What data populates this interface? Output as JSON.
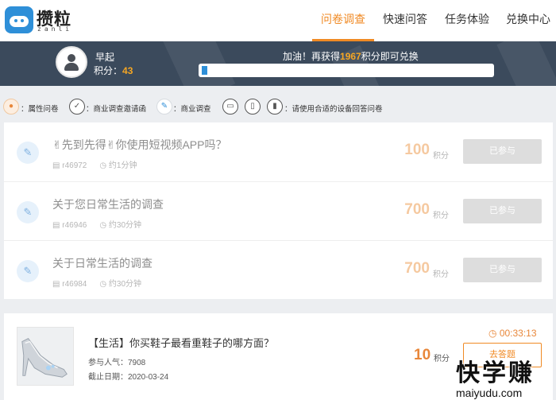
{
  "brand": {
    "name": "攒粒",
    "sub": "zanli"
  },
  "nav": {
    "items": [
      "问卷调查",
      "快速问答",
      "任务体验",
      "兑换中心"
    ],
    "active_index": 0
  },
  "user": {
    "name": "早起",
    "points_label": "积分：",
    "points": "43",
    "cheer_before": "加油！再获得",
    "cheer_points": "1967",
    "cheer_after": "积分即可兑换",
    "progress_fraction": 0.02
  },
  "filters": {
    "items": [
      {
        "icon": "user-plus-icon",
        "label": "：属性问卷"
      },
      {
        "icon": "check-circle-icon",
        "label": "：商业调查邀请函"
      },
      {
        "icon": "edit-icon",
        "label": "：商业调查"
      }
    ],
    "device_icons": [
      "monitor-icon",
      "phone-icon",
      "tablet-icon"
    ],
    "device_label": "：请使用合适的设备回答问卷"
  },
  "surveys": [
    {
      "title": "✌先到先得✌你使用短视频APP吗？",
      "id": "r46972",
      "duration": "约1分钟",
      "points": "100",
      "points_label": "积分",
      "button": "已参与"
    },
    {
      "title": "关于您日常生活的调查",
      "id": "r46946",
      "duration": "约30分钟",
      "points": "700",
      "points_label": "积分",
      "button": "已参与"
    },
    {
      "title": "关于日常生活的调查",
      "id": "r46984",
      "duration": "约30分钟",
      "points": "700",
      "points_label": "积分",
      "button": "已参与"
    }
  ],
  "product": {
    "title": "【生活】你买鞋子最看重鞋子的哪方面？",
    "popularity_label": "参与人气：",
    "popularity": "7908",
    "deadline_label": "截止日期：",
    "deadline": "2020-03-24",
    "timer": "00:33:13",
    "points": "10",
    "points_label": "积分",
    "button": "去答题"
  },
  "watermark": {
    "big": "快学赚",
    "small": "maiyudu.com"
  },
  "colors": {
    "accent": "#f08a24",
    "banner": "#3b4a5c",
    "brand_blue": "#2e8fd8"
  }
}
